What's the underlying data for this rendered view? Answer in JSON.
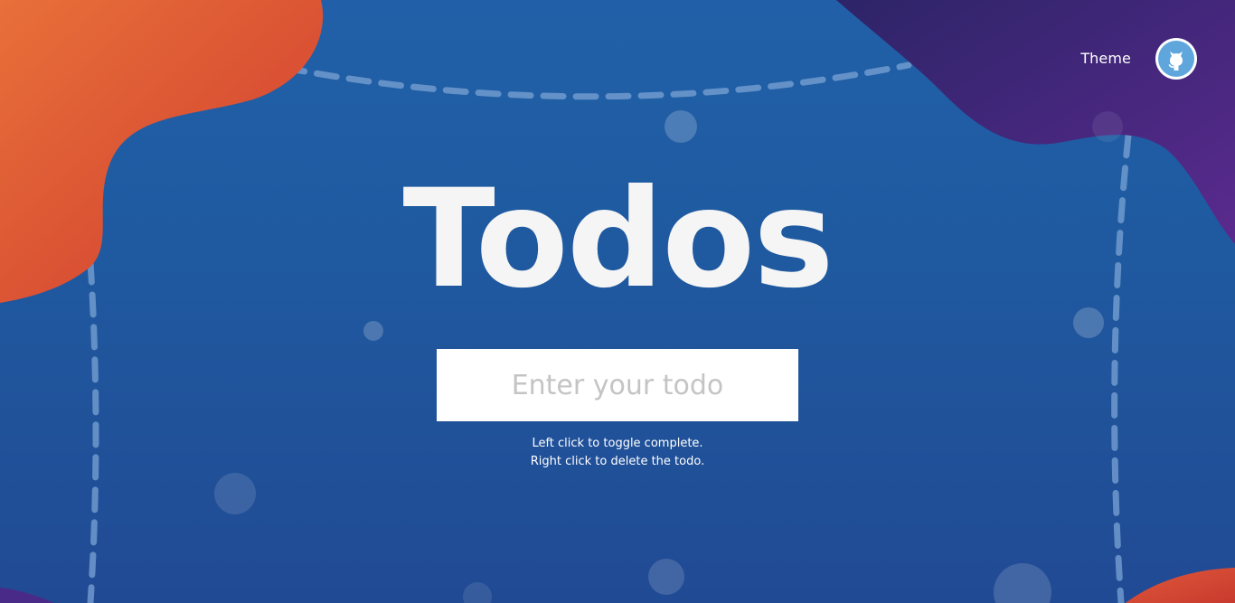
{
  "header": {
    "theme_label": "Theme",
    "github_icon": "github-icon"
  },
  "main": {
    "title": "Todos",
    "input": {
      "value": "",
      "placeholder": "Enter your todo"
    },
    "hints": [
      "Left click to toggle complete.",
      "Right click to delete the todo."
    ]
  },
  "colors": {
    "background": "#2160a8",
    "blob_orange": "#e0583a",
    "blob_purple": "#4a2a88",
    "title": "#f5f5f5",
    "github_badge": "#5fa6dc"
  }
}
